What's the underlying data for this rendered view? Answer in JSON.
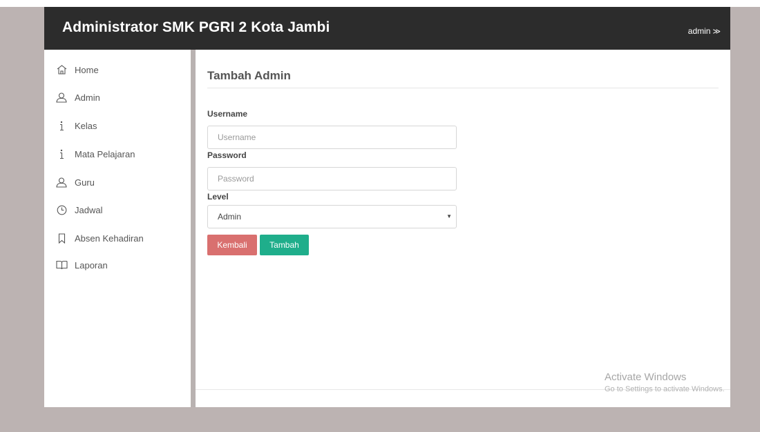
{
  "header": {
    "title": "Administrator SMK PGRI 2 Kota Jambi",
    "user_label": "admin",
    "user_chevron": "≫"
  },
  "sidebar": {
    "items": [
      {
        "label": "Home",
        "icon": "home-icon"
      },
      {
        "label": "Admin",
        "icon": "user-icon"
      },
      {
        "label": "Kelas",
        "icon": "info-icon"
      },
      {
        "label": "Mata Pelajaran",
        "icon": "info-icon"
      },
      {
        "label": "Guru",
        "icon": "user-icon"
      },
      {
        "label": "Jadwal",
        "icon": "clock-icon"
      },
      {
        "label": "Absen Kehadiran",
        "icon": "bookmark-icon"
      },
      {
        "label": "Laporan",
        "icon": "book-icon"
      }
    ]
  },
  "form": {
    "title": "Tambah Admin",
    "username_label": "Username",
    "username_placeholder": "Username",
    "password_label": "Password",
    "password_placeholder": "Password",
    "level_label": "Level",
    "level_selected": "Admin",
    "back_button": "Kembali",
    "add_button": "Tambah"
  },
  "watermark": {
    "line1": "Activate Windows",
    "line2": "Go to Settings to activate Windows."
  },
  "colors": {
    "header_bg": "#2c2c2c",
    "back_button": "#d9706f",
    "add_button": "#1fae8b",
    "page_bg": "#bcb3b2"
  }
}
